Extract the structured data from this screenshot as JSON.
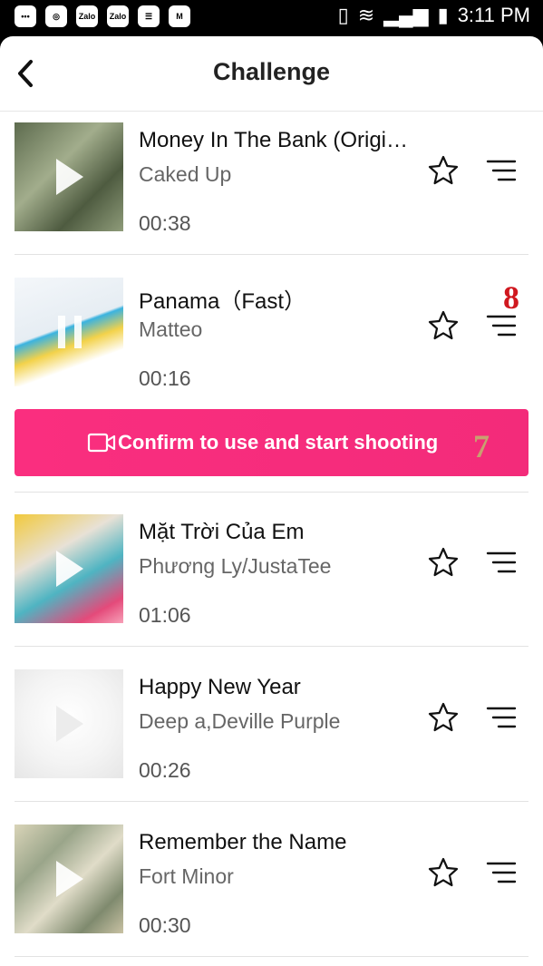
{
  "status_bar": {
    "app_icons": [
      "chat-icon",
      "chrome-icon",
      "zalo-icon",
      "zalo-icon",
      "news-icon",
      "gmail-icon"
    ],
    "zalo_label": "Zalo",
    "time": "3:11 PM"
  },
  "header": {
    "title": "Challenge"
  },
  "songs": [
    {
      "title": "Money In The Bank (Original Mix)",
      "artist": "Caked Up",
      "duration": "00:38",
      "state": "play"
    },
    {
      "title": "Panama（Fast）",
      "artist": "Matteo",
      "duration": "00:16",
      "state": "pause"
    },
    {
      "title": "Mặt Trời Của Em",
      "artist": "Phương Ly/JustaTee",
      "duration": "01:06",
      "state": "play"
    },
    {
      "title": "Happy New Year",
      "artist": "Deep a,Deville Purple",
      "duration": "00:26",
      "state": "play"
    },
    {
      "title": "Remember the Name",
      "artist": "Fort Minor",
      "duration": "00:30",
      "state": "play"
    }
  ],
  "confirm_button": {
    "label": "Confirm to use and start shooting"
  },
  "annotations": {
    "marker_7": "7",
    "marker_8": "8"
  },
  "colors": {
    "accent": "#f72d7d",
    "annotation": "#d0181f"
  }
}
